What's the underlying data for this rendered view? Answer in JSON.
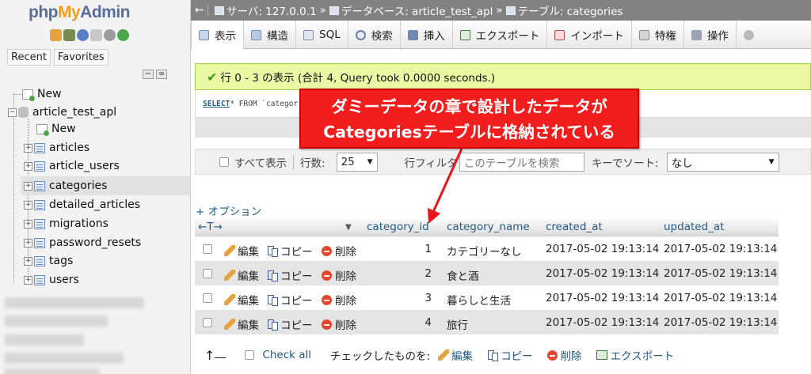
{
  "app": {
    "logo_php": "php",
    "logo_my": "My",
    "logo_admin": "Admin"
  },
  "sidebar": {
    "tab_recent": "Recent",
    "tab_favorites": "Favorites",
    "collapse_label": "−",
    "link_label": "∞",
    "new_top": "New",
    "database": "article_test_apl",
    "new_in_db": "New",
    "tables": [
      "articles",
      "article_users",
      "categories",
      "detailed_articles",
      "migrations",
      "password_resets",
      "tags",
      "users"
    ],
    "selected_table": "categories"
  },
  "breadcrumb": {
    "back": "←",
    "server": "サーバ: 127.0.0.1",
    "database": "データベース: article_test_apl",
    "table": "テーブル: categories",
    "sep": "»"
  },
  "menu_tabs": [
    "表示",
    "構造",
    "SQL",
    "検索",
    "挿入",
    "エクスポート",
    "インポート",
    "特権",
    "操作"
  ],
  "success": {
    "message": "行 0 - 3 の表示 (合計 4, Query took 0.0000 seconds.)"
  },
  "sql": {
    "select_kw": "SELECT",
    "rest": " * FROM `categor"
  },
  "callout": {
    "line1": "ダミーデータの章で設計したデータが",
    "line2": "Categoriesテーブルに格納されている"
  },
  "controls": {
    "show_all": "すべて表示",
    "rows_label": "行数:",
    "rows_value": "25",
    "filter_label": "行フィルタ",
    "filter_placeholder": "このテーブルを検索",
    "sort_label": "キーでソート:",
    "sort_value": "なし",
    "dropdown_arrow": "▼"
  },
  "options_link": "+ オプション",
  "table": {
    "arrows": "←T→",
    "sort_caret": "▼",
    "headers": [
      "category_id",
      "category_name",
      "created_at",
      "updated_at"
    ],
    "actions": {
      "edit": "編集",
      "copy": "コピー",
      "delete": "削除"
    },
    "rows": [
      {
        "category_id": "1",
        "category_name": "カテゴリーなし",
        "created_at": "2017-05-02 19:13:14",
        "updated_at": "2017-05-02 19:13:14"
      },
      {
        "category_id": "2",
        "category_name": "食と酒",
        "created_at": "2017-05-02 19:13:14",
        "updated_at": "2017-05-02 19:13:14"
      },
      {
        "category_id": "3",
        "category_name": "暮らしと生活",
        "created_at": "2017-05-02 19:13:14",
        "updated_at": "2017-05-02 19:13:14"
      },
      {
        "category_id": "4",
        "category_name": "旅行",
        "created_at": "2017-05-02 19:13:14",
        "updated_at": "2017-05-02 19:13:14"
      }
    ]
  },
  "bulk": {
    "up_arrow": "↑",
    "check_all": "Check all",
    "with_selected": "チェックしたものを:",
    "edit": "編集",
    "copy": "コピー",
    "delete": "削除",
    "export": "エクスポート"
  },
  "colors": {
    "callout_red": "#f21d1d",
    "success_bg": "#ebf8a4",
    "link_blue": "#235a81",
    "topbar_gray": "#828282"
  }
}
